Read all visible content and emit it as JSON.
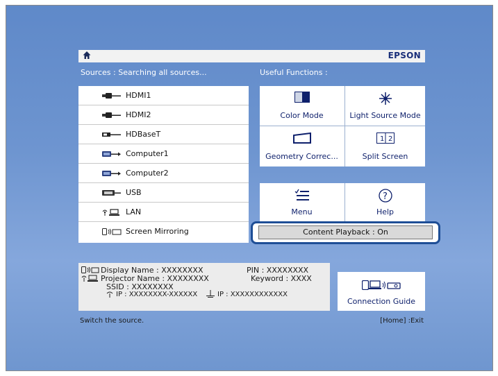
{
  "topbar": {
    "brand": "EPSON",
    "home_icon": "home-icon"
  },
  "sources": {
    "header": "Sources : Searching all sources...",
    "items": [
      {
        "label": "HDMI1",
        "icon": "hdmi-icon"
      },
      {
        "label": "HDMI2",
        "icon": "hdmi-icon"
      },
      {
        "label": "HDBaseT",
        "icon": "hdbaset-icon"
      },
      {
        "label": "Computer1",
        "icon": "computer-icon"
      },
      {
        "label": "Computer2",
        "icon": "computer-icon"
      },
      {
        "label": "USB",
        "icon": "usb-icon"
      },
      {
        "label": "LAN",
        "icon": "lan-icon"
      },
      {
        "label": "Screen Mirroring",
        "icon": "screen-mirroring-icon"
      }
    ]
  },
  "functions": {
    "header": "Useful Functions :",
    "items": [
      {
        "label": "Color Mode",
        "icon": "color-mode-icon"
      },
      {
        "label": "Light Source Mode",
        "icon": "light-source-icon"
      },
      {
        "label": "Geometry Correc...",
        "icon": "geometry-icon"
      },
      {
        "label": "Split Screen",
        "icon": "split-screen-icon"
      },
      {
        "label": "Menu",
        "icon": "menu-icon"
      },
      {
        "label": "Help",
        "icon": "help-icon"
      }
    ],
    "content_playback": "Content Playback : On"
  },
  "info": {
    "display_name": "Display Name : XXXXXXXX",
    "projector_name": "Projector Name : XXXXXXXX",
    "ssid": "SSID : XXXXXXXX",
    "ip1": "IP : XXXXXXXX-XXXXXX",
    "ip2": "IP : XXXXXXXXXXXX",
    "pin": "PIN : XXXXXXXX",
    "keyword": "Keyword : XXXX"
  },
  "connection_guide": {
    "label": "Connection Guide",
    "icon": "connection-guide-icon"
  },
  "status": {
    "left": "Switch the source.",
    "right": "[Home] :Exit"
  }
}
